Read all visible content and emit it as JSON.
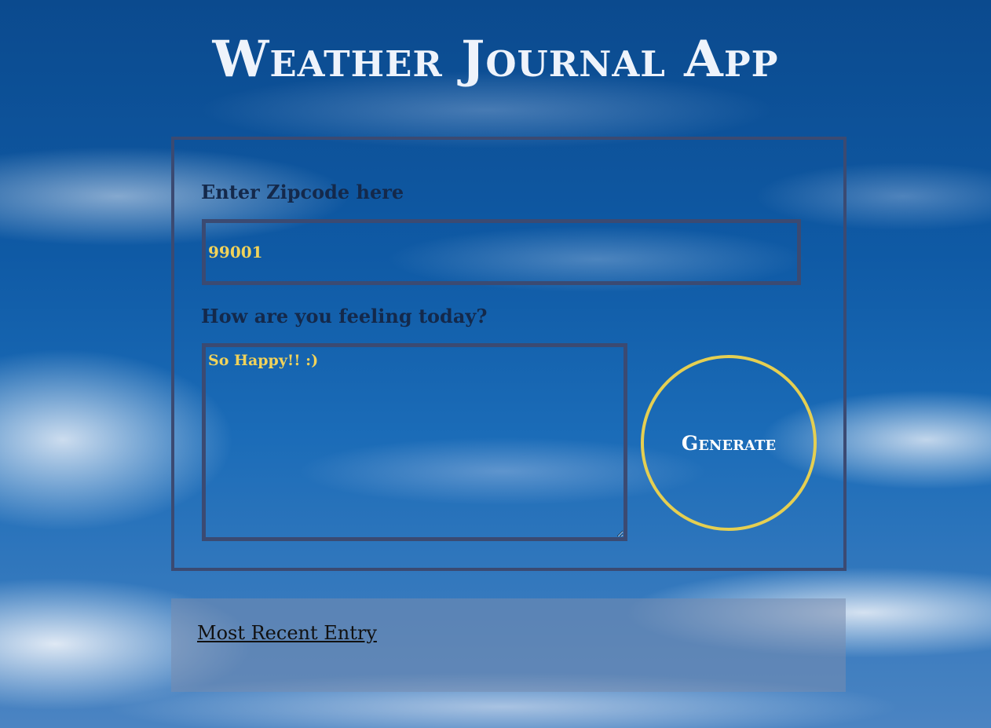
{
  "app": {
    "title": "Weather Journal App"
  },
  "form": {
    "zip_label": "Enter Zipcode here",
    "zip_value": "99001",
    "feelings_label": "How are you feeling today?",
    "feelings_value": "So Happy!! :)",
    "generate_label": "Generate"
  },
  "entry": {
    "title": "Most Recent Entry"
  },
  "colors": {
    "accent": "#e5cf52",
    "input_text": "#f1d35a",
    "border": "#3b4a72",
    "label": "#14294b"
  }
}
